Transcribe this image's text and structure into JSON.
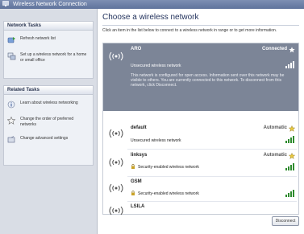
{
  "window": {
    "title": "Wireless Network Connection"
  },
  "sidebar": {
    "network_tasks": {
      "heading": "Network Tasks",
      "items": [
        {
          "label": "Refresh network list",
          "icon": "refresh-icon"
        },
        {
          "label": "Set up a wireless network for a home or small office",
          "icon": "setup-network-icon"
        }
      ]
    },
    "related_tasks": {
      "heading": "Related Tasks",
      "items": [
        {
          "label": "Learn about wireless networking",
          "icon": "info-icon"
        },
        {
          "label": "Change the order of preferred networks",
          "icon": "star-icon"
        },
        {
          "label": "Change advanced settings",
          "icon": "settings-icon"
        }
      ]
    }
  },
  "main": {
    "title": "Choose a wireless network",
    "instructions": "Click an item in the list below to connect to a wireless network in range or to get more information.",
    "networks": [
      {
        "ssid": "ARO",
        "status": "Connected",
        "description": "Unsecured wireless network",
        "detail": "This network is configured for open access. Information sent over this network may be visible to others. You are currently connected to this network. To disconnect from this network, click Disconnect.",
        "signal": 4
      },
      {
        "ssid": "default",
        "status": "Automatic",
        "description": "Unsecured wireless network",
        "signal": 4
      },
      {
        "ssid": "linksys",
        "status": "Automatic",
        "description": "Security-enabled wireless network",
        "signal": 4
      },
      {
        "ssid": "GSM",
        "status": "",
        "description": "Security-enabled wireless network",
        "signal": 4
      },
      {
        "ssid": "LSILA",
        "status": "",
        "description": "",
        "signal": 0
      }
    ],
    "connect_button": "Disconnect"
  },
  "colors": {
    "titlebar": "#6b7fa8",
    "sidebar": "#d9dde5",
    "selected_row": "#7c8597",
    "signal_bar": "#2e8b2e"
  }
}
